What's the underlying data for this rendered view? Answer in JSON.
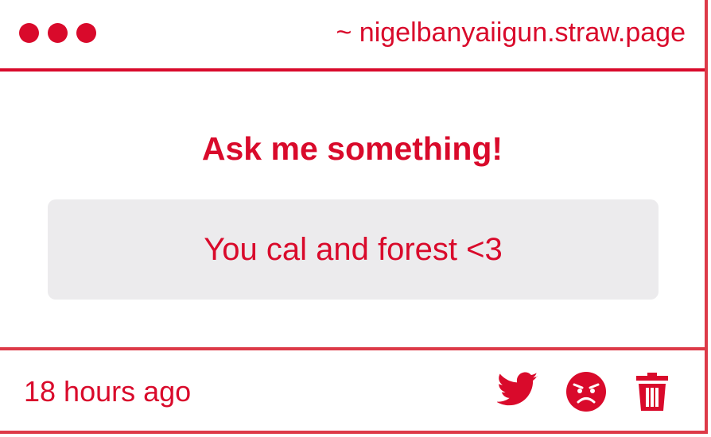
{
  "header": {
    "url": "~ nigelbanyaiigun.straw.page"
  },
  "main": {
    "title": "Ask me something!",
    "message": "You cal and forest <3"
  },
  "footer": {
    "time": "18 hours ago",
    "icons": [
      "twitter-icon",
      "angry-face-icon",
      "trash-icon"
    ]
  },
  "colors": {
    "accent": "#d90a2b",
    "message_background": "#ecebed",
    "border": "#dd3a48",
    "background": "#ffffff"
  }
}
